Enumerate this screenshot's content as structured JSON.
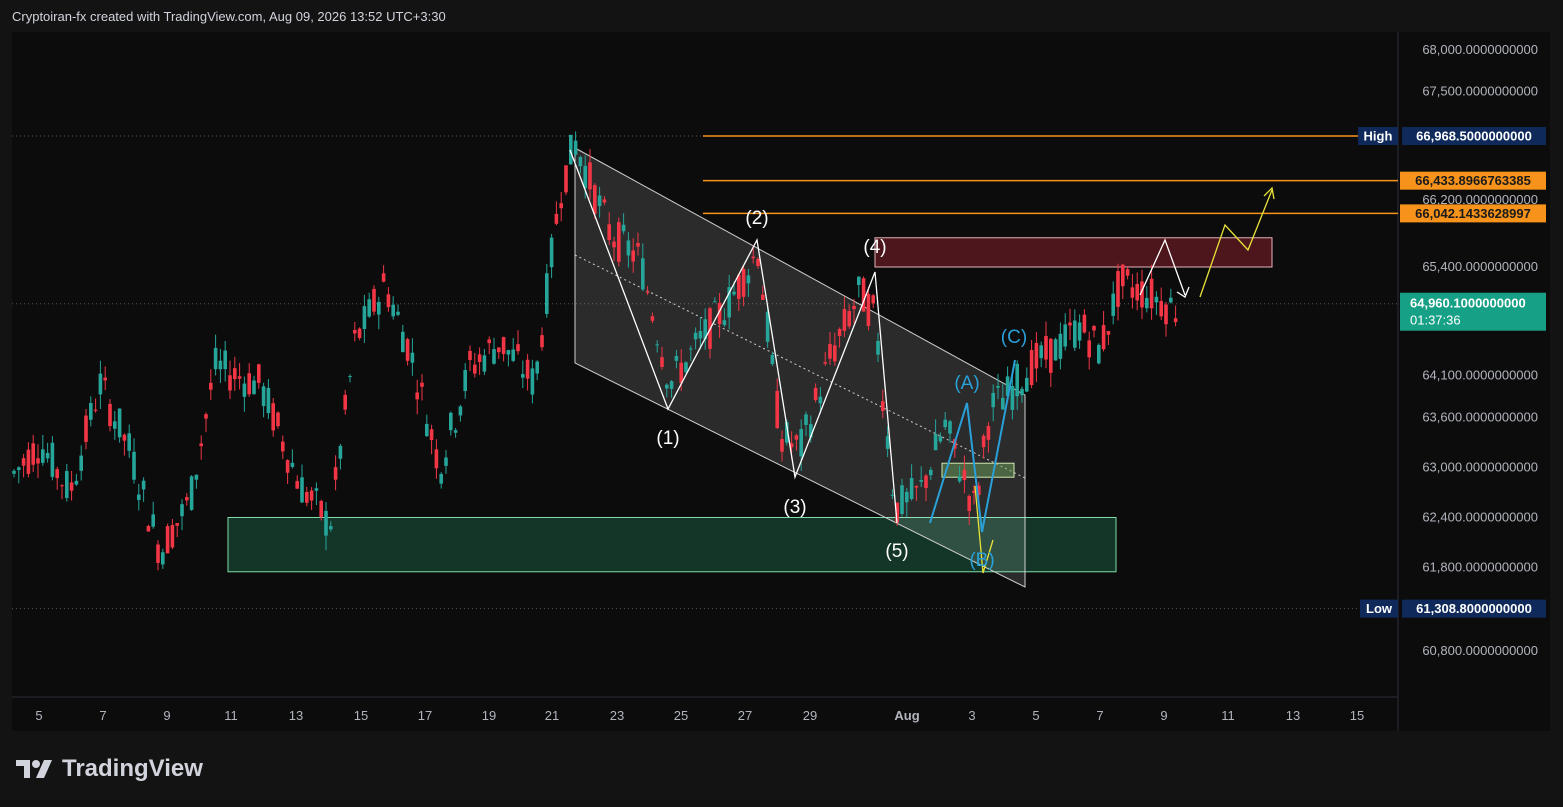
{
  "header": "Cryptoiran-fx created with TradingView.com, Aug 09, 2026 13:52 UTC+3:30",
  "brand": "TradingView",
  "chart_data": {
    "type": "candlestick",
    "ylim": [
      60300,
      68400
    ],
    "y_ticks": [
      {
        "label": "68,000.0000000000",
        "value": 68000
      },
      {
        "label": "67,500.0000000000",
        "value": 67500
      },
      {
        "label": "66,200.0000000000",
        "value": 66200
      },
      {
        "label": "65,400.0000000000",
        "value": 65400
      },
      {
        "label": "64,100.0000000000",
        "value": 64100
      },
      {
        "label": "63,600.0000000000",
        "value": 63600
      },
      {
        "label": "63,000.0000000000",
        "value": 63000
      },
      {
        "label": "62,400.0000000000",
        "value": 62400
      },
      {
        "label": "61,800.0000000000",
        "value": 61800
      },
      {
        "label": "60,800.0000000000",
        "value": 60800
      }
    ],
    "x_ticks": [
      "5",
      "7",
      "9",
      "11",
      "13",
      "15",
      "17",
      "19",
      "21",
      "23",
      "25",
      "27",
      "29",
      "Aug",
      "3",
      "5",
      "7",
      "9",
      "11",
      "13",
      "15"
    ],
    "high": {
      "tag": "High",
      "value": "66,968.5000000000",
      "price": 66968.5
    },
    "low": {
      "tag": "Low",
      "value": "61,308.8000000000",
      "price": 61308.8
    },
    "levels": [
      {
        "value": "66,433.8966763385",
        "price": 66433.9
      },
      {
        "value": "66,042.1433628997",
        "price": 66042.1
      }
    ],
    "current": {
      "value": "64,960.1000000000",
      "countdown": "01:37:36",
      "price": 64960.1
    },
    "wave_labels": [
      "(1)",
      "(2)",
      "(3)",
      "(4)",
      "(5)",
      "(A)",
      "(B)",
      "(C)"
    ],
    "zones": [
      {
        "name": "support-zone",
        "top": 62400,
        "bottom": 61750
      },
      {
        "name": "resistance-zone",
        "top": 65750,
        "bottom": 65400
      }
    ],
    "colors": {
      "up": "#26a69a",
      "down": "#f23645",
      "level": "#f7931a",
      "wave": "#ffffff",
      "corrective": "#29a0d8",
      "projection": "#e8e23a"
    }
  }
}
